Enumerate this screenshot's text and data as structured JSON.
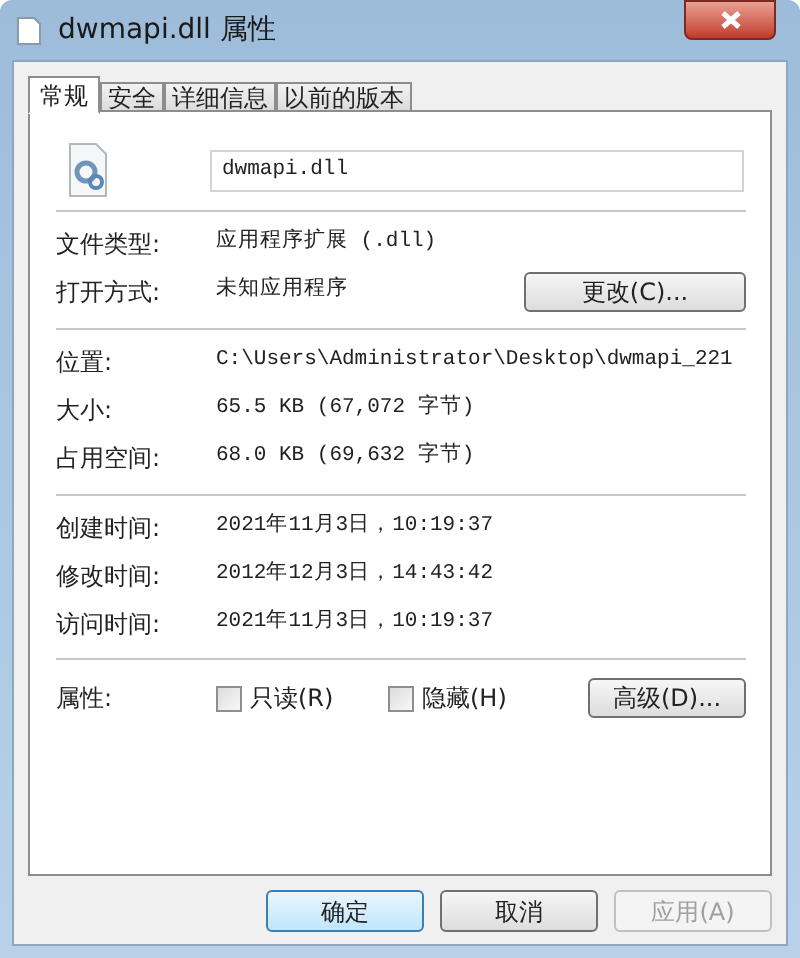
{
  "window": {
    "title": "dwmapi.dll 属性"
  },
  "tabs": [
    {
      "label": "常规",
      "selected": true
    },
    {
      "label": "安全",
      "selected": false
    },
    {
      "label": "详细信息",
      "selected": false
    },
    {
      "label": "以前的版本",
      "selected": false
    }
  ],
  "file": {
    "name": "dwmapi.dll"
  },
  "sections": [
    [
      {
        "label": "文件类型:",
        "value": "应用程序扩展 (.dll)"
      },
      {
        "label": "打开方式:",
        "value": "未知应用程序",
        "button": "更改(C)..."
      }
    ],
    [
      {
        "label": "位置:",
        "value": "C:\\Users\\Administrator\\Desktop\\dwmapi_221"
      },
      {
        "label": "大小:",
        "value": "65.5 KB (67,072 字节)"
      },
      {
        "label": "占用空间:",
        "value": "68.0 KB (69,632 字节)"
      }
    ],
    [
      {
        "label": "创建时间:",
        "value": "2021年11月3日，10:19:37"
      },
      {
        "label": "修改时间:",
        "value": "2012年12月3日，14:43:42"
      },
      {
        "label": "访问时间:",
        "value": "2021年11月3日，10:19:37"
      }
    ]
  ],
  "attributes": {
    "label": "属性:",
    "checkboxes": [
      {
        "label": "只读(R)",
        "checked": false
      },
      {
        "label": "隐藏(H)",
        "checked": false
      }
    ],
    "button": "高级(D)..."
  },
  "buttons": [
    {
      "label": "确定",
      "default": true,
      "disabled": false
    },
    {
      "label": "取消",
      "default": false,
      "disabled": false
    },
    {
      "label": "应用(A)",
      "default": false,
      "disabled": true
    }
  ]
}
